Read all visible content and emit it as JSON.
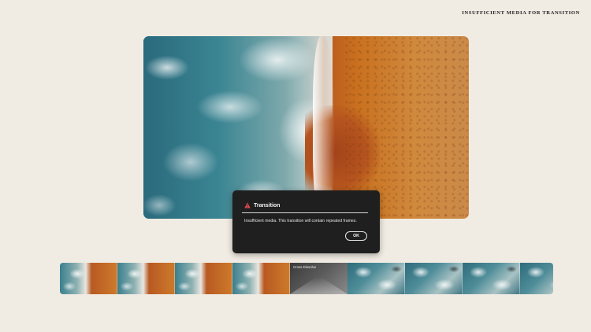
{
  "page": {
    "heading": "INSUFFICIENT MEDIA FOR TRANSITION"
  },
  "dialog": {
    "icon": "warning-icon",
    "title": "Transition",
    "message": "Insufficient media. This transition will contain repeated frames.",
    "ok_label": "OK"
  },
  "filmstrip": {
    "transition_label": "Cross Dissolve"
  },
  "colors": {
    "background": "#f1ece3",
    "dialog_background": "#1f1f1f",
    "warning": "#e34850"
  }
}
